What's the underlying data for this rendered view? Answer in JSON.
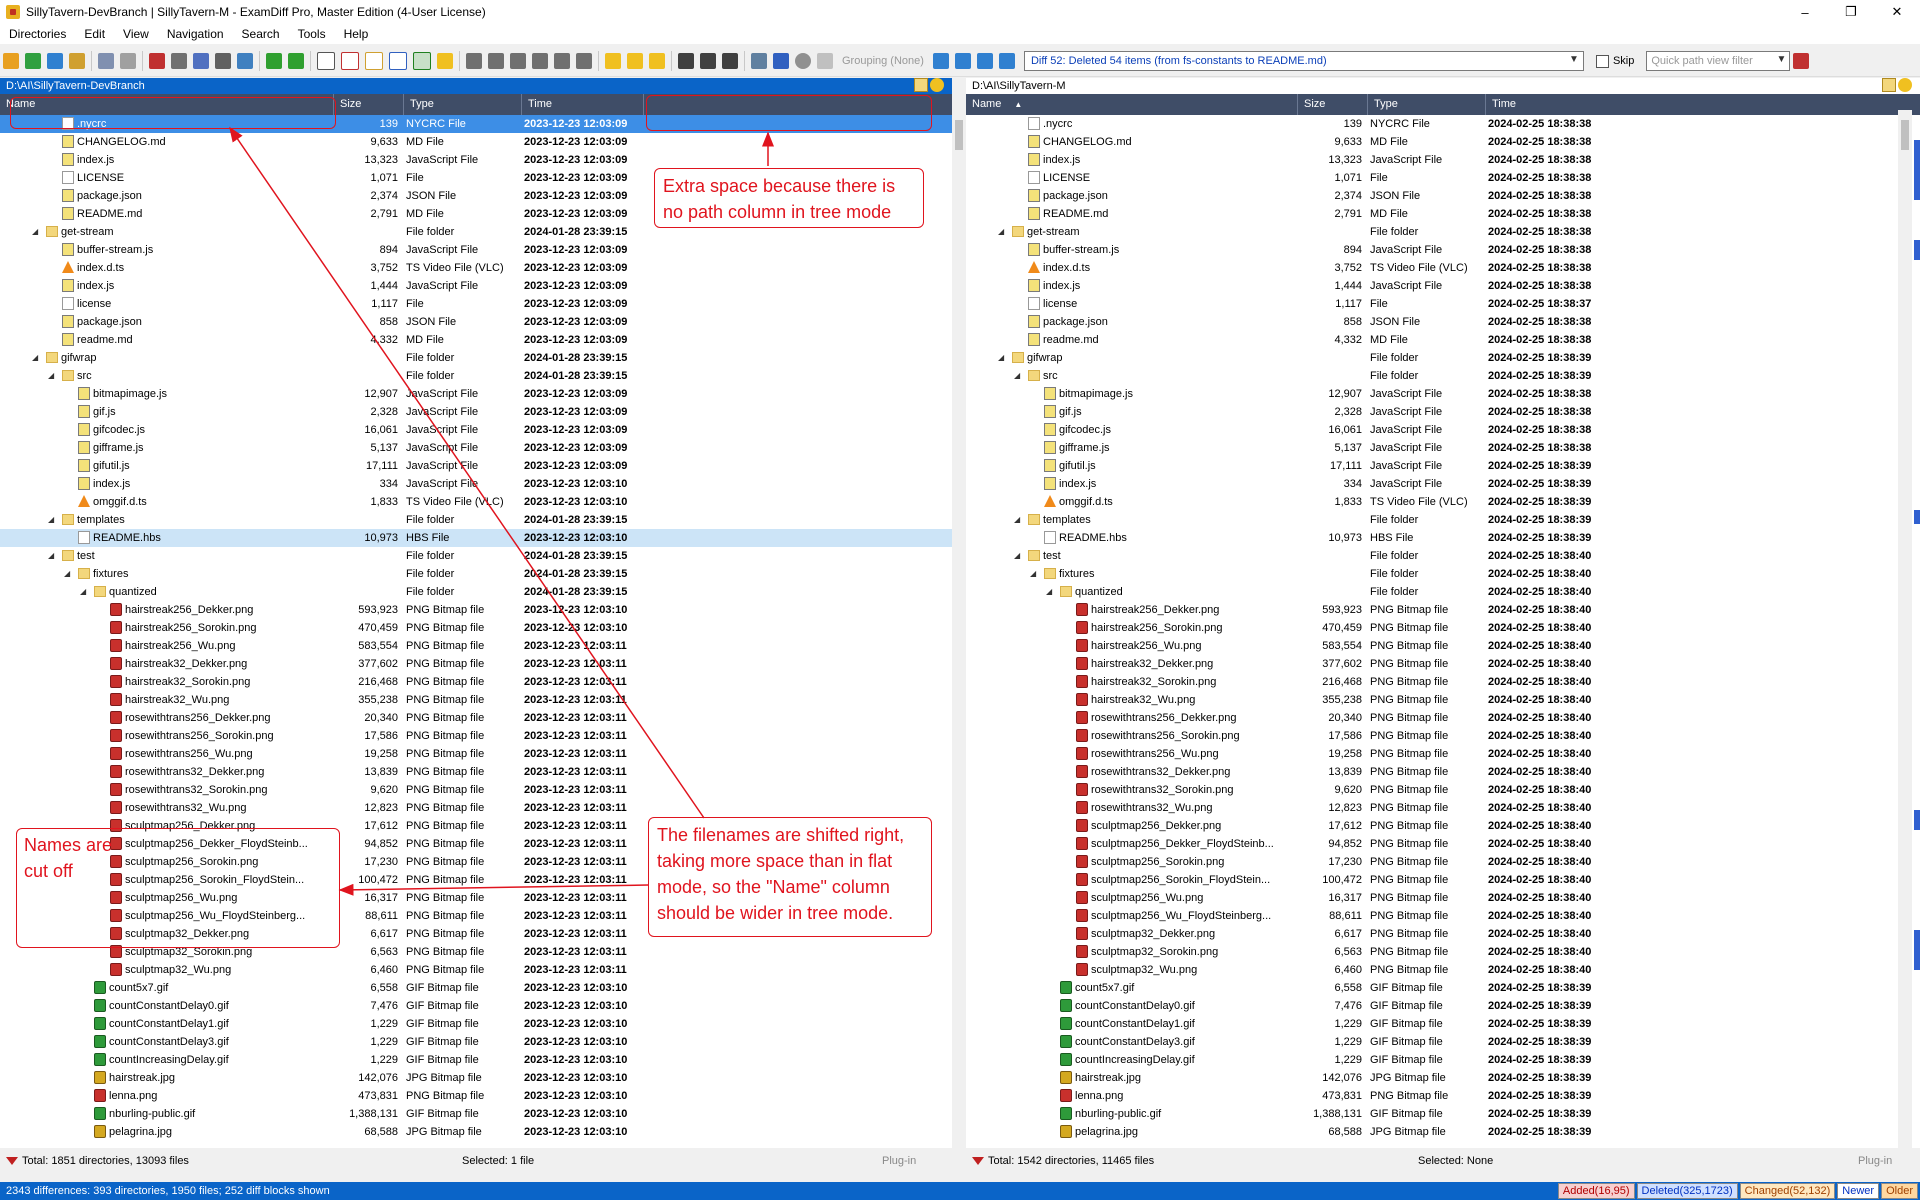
{
  "window": {
    "title": "SillyTavern-DevBranch  |  SillyTavern-M - ExamDiff Pro, Master Edition (4-User License)",
    "controls": [
      "–",
      "❐",
      "✕"
    ]
  },
  "menu": [
    "Directories",
    "Edit",
    "View",
    "Navigation",
    "Search",
    "Tools",
    "Help"
  ],
  "toolbar": {
    "grouping": "Grouping (None)",
    "diff_summary": "Diff 52: Deleted 54 items (from fs-constants to README.md)",
    "skip_label": "Skip",
    "quick_filter_placeholder": "Quick path view filter"
  },
  "left_pane": {
    "path": "D:\\AI\\SillyTavern-DevBranch",
    "columns": {
      "name": "Name",
      "size": "Size",
      "type": "Type",
      "time": "Time"
    },
    "status_total": "Total: 1851 directories, 13093 files",
    "status_selected": "Selected: 1 file",
    "status_plugin": "Plug-in"
  },
  "right_pane": {
    "path": "D:\\AI\\SillyTavern-M",
    "columns": {
      "name": "Name",
      "size": "Size",
      "type": "Type",
      "time": "Time"
    },
    "status_total": "Total: 1542 directories, 11465 files",
    "status_selected": "Selected: None",
    "status_plugin": "Plug-in"
  },
  "rows": [
    {
      "name": ".nycrc",
      "level": 3,
      "icon": "file",
      "size": "139",
      "type": "NYCRC File",
      "left_time": "2023-12-23 12:03:09",
      "right_time": "2024-02-25 18:38:38",
      "state": "sel"
    },
    {
      "name": "CHANGELOG.md",
      "level": 3,
      "icon": "js",
      "size": "9,633",
      "type": "MD File",
      "left_time": "2023-12-23 12:03:09",
      "right_time": "2024-02-25 18:38:38"
    },
    {
      "name": "index.js",
      "level": 3,
      "icon": "js",
      "size": "13,323",
      "type": "JavaScript File",
      "left_time": "2023-12-23 12:03:09",
      "right_time": "2024-02-25 18:38:38"
    },
    {
      "name": "LICENSE",
      "level": 3,
      "icon": "file",
      "size": "1,071",
      "type": "File",
      "left_time": "2023-12-23 12:03:09",
      "right_time": "2024-02-25 18:38:38"
    },
    {
      "name": "package.json",
      "level": 3,
      "icon": "js",
      "size": "2,374",
      "type": "JSON File",
      "left_time": "2023-12-23 12:03:09",
      "right_time": "2024-02-25 18:38:38"
    },
    {
      "name": "README.md",
      "level": 3,
      "icon": "js",
      "size": "2,791",
      "type": "MD File",
      "left_time": "2023-12-23 12:03:09",
      "right_time": "2024-02-25 18:38:38"
    },
    {
      "name": "get-stream",
      "level": 2,
      "icon": "folder",
      "tri": true,
      "size": "",
      "type": "File folder",
      "left_time": "2024-01-28 23:39:15",
      "right_time": "2024-02-25 18:38:38"
    },
    {
      "name": "buffer-stream.js",
      "level": 3,
      "icon": "js",
      "size": "894",
      "type": "JavaScript File",
      "left_time": "2023-12-23 12:03:09",
      "right_time": "2024-02-25 18:38:38"
    },
    {
      "name": "index.d.ts",
      "level": 3,
      "icon": "vlc",
      "size": "3,752",
      "type": "TS Video File (VLC)",
      "left_time": "2023-12-23 12:03:09",
      "right_time": "2024-02-25 18:38:38"
    },
    {
      "name": "index.js",
      "level": 3,
      "icon": "js",
      "size": "1,444",
      "type": "JavaScript File",
      "left_time": "2023-12-23 12:03:09",
      "right_time": "2024-02-25 18:38:38"
    },
    {
      "name": "license",
      "level": 3,
      "icon": "file",
      "size": "1,117",
      "type": "File",
      "left_time": "2023-12-23 12:03:09",
      "right_time": "2024-02-25 18:38:37"
    },
    {
      "name": "package.json",
      "level": 3,
      "icon": "js",
      "size": "858",
      "type": "JSON File",
      "left_time": "2023-12-23 12:03:09",
      "right_time": "2024-02-25 18:38:38"
    },
    {
      "name": "readme.md",
      "level": 3,
      "icon": "js",
      "size": "4,332",
      "type": "MD File",
      "left_time": "2023-12-23 12:03:09",
      "right_time": "2024-02-25 18:38:38"
    },
    {
      "name": "gifwrap",
      "level": 2,
      "icon": "folder",
      "tri": true,
      "size": "",
      "type": "File folder",
      "left_time": "2024-01-28 23:39:15",
      "right_time": "2024-02-25 18:38:39"
    },
    {
      "name": "src",
      "level": 3,
      "icon": "folder",
      "tri": true,
      "size": "",
      "type": "File folder",
      "left_time": "2024-01-28 23:39:15",
      "right_time": "2024-02-25 18:38:39"
    },
    {
      "name": "bitmapimage.js",
      "level": 4,
      "icon": "js",
      "size": "12,907",
      "type": "JavaScript File",
      "left_time": "2023-12-23 12:03:09",
      "right_time": "2024-02-25 18:38:38"
    },
    {
      "name": "gif.js",
      "level": 4,
      "icon": "js",
      "size": "2,328",
      "type": "JavaScript File",
      "left_time": "2023-12-23 12:03:09",
      "right_time": "2024-02-25 18:38:38"
    },
    {
      "name": "gifcodec.js",
      "level": 4,
      "icon": "js",
      "size": "16,061",
      "type": "JavaScript File",
      "left_time": "2023-12-23 12:03:09",
      "right_time": "2024-02-25 18:38:38"
    },
    {
      "name": "gifframe.js",
      "level": 4,
      "icon": "js",
      "size": "5,137",
      "type": "JavaScript File",
      "left_time": "2023-12-23 12:03:09",
      "right_time": "2024-02-25 18:38:38"
    },
    {
      "name": "gifutil.js",
      "level": 4,
      "icon": "js",
      "size": "17,111",
      "type": "JavaScript File",
      "left_time": "2023-12-23 12:03:09",
      "right_time": "2024-02-25 18:38:39"
    },
    {
      "name": "index.js",
      "level": 4,
      "icon": "js",
      "size": "334",
      "type": "JavaScript File",
      "left_time": "2023-12-23 12:03:10",
      "right_time": "2024-02-25 18:38:39"
    },
    {
      "name": "omggif.d.ts",
      "level": 4,
      "icon": "vlc",
      "size": "1,833",
      "type": "TS Video File (VLC)",
      "left_time": "2023-12-23 12:03:10",
      "right_time": "2024-02-25 18:38:39"
    },
    {
      "name": "templates",
      "level": 3,
      "icon": "folder",
      "tri": true,
      "size": "",
      "type": "File folder",
      "left_time": "2024-01-28 23:39:15",
      "right_time": "2024-02-25 18:38:39"
    },
    {
      "name": "README.hbs",
      "level": 4,
      "icon": "file",
      "size": "10,973",
      "type": "HBS File",
      "left_time": "2023-12-23 12:03:10",
      "right_time": "2024-02-25 18:38:39",
      "state": "hl"
    },
    {
      "name": "test",
      "level": 3,
      "icon": "folder",
      "tri": true,
      "size": "",
      "type": "File folder",
      "left_time": "2024-01-28 23:39:15",
      "right_time": "2024-02-25 18:38:40"
    },
    {
      "name": "fixtures",
      "level": 4,
      "icon": "folder",
      "tri": true,
      "size": "",
      "type": "File folder",
      "left_time": "2024-01-28 23:39:15",
      "right_time": "2024-02-25 18:38:40"
    },
    {
      "name": "quantized",
      "level": 5,
      "icon": "folder",
      "tri": true,
      "size": "",
      "type": "File folder",
      "left_time": "2024-01-28 23:39:15",
      "right_time": "2024-02-25 18:38:40"
    },
    {
      "name": "hairstreak256_Dekker.png",
      "level": 6,
      "icon": "img",
      "size": "593,923",
      "type": "PNG Bitmap file",
      "left_time": "2023-12-23 12:03:10",
      "right_time": "2024-02-25 18:38:40"
    },
    {
      "name": "hairstreak256_Sorokin.png",
      "level": 6,
      "icon": "img",
      "size": "470,459",
      "type": "PNG Bitmap file",
      "left_time": "2023-12-23 12:03:10",
      "right_time": "2024-02-25 18:38:40"
    },
    {
      "name": "hairstreak256_Wu.png",
      "level": 6,
      "icon": "img",
      "size": "583,554",
      "type": "PNG Bitmap file",
      "left_time": "2023-12-23 12:03:11",
      "right_time": "2024-02-25 18:38:40"
    },
    {
      "name": "hairstreak32_Dekker.png",
      "level": 6,
      "icon": "img",
      "size": "377,602",
      "type": "PNG Bitmap file",
      "left_time": "2023-12-23 12:03:11",
      "right_time": "2024-02-25 18:38:40"
    },
    {
      "name": "hairstreak32_Sorokin.png",
      "level": 6,
      "icon": "img",
      "size": "216,468",
      "type": "PNG Bitmap file",
      "left_time": "2023-12-23 12:03:11",
      "right_time": "2024-02-25 18:38:40"
    },
    {
      "name": "hairstreak32_Wu.png",
      "level": 6,
      "icon": "img",
      "size": "355,238",
      "type": "PNG Bitmap file",
      "left_time": "2023-12-23 12:03:11",
      "right_time": "2024-02-25 18:38:40"
    },
    {
      "name": "rosewithtrans256_Dekker.png",
      "level": 6,
      "icon": "img",
      "size": "20,340",
      "type": "PNG Bitmap file",
      "left_time": "2023-12-23 12:03:11",
      "right_time": "2024-02-25 18:38:40"
    },
    {
      "name": "rosewithtrans256_Sorokin.png",
      "level": 6,
      "icon": "img",
      "size": "17,586",
      "type": "PNG Bitmap file",
      "left_time": "2023-12-23 12:03:11",
      "right_time": "2024-02-25 18:38:40"
    },
    {
      "name": "rosewithtrans256_Wu.png",
      "level": 6,
      "icon": "img",
      "size": "19,258",
      "type": "PNG Bitmap file",
      "left_time": "2023-12-23 12:03:11",
      "right_time": "2024-02-25 18:38:40"
    },
    {
      "name": "rosewithtrans32_Dekker.png",
      "level": 6,
      "icon": "img",
      "size": "13,839",
      "type": "PNG Bitmap file",
      "left_time": "2023-12-23 12:03:11",
      "right_time": "2024-02-25 18:38:40"
    },
    {
      "name": "rosewithtrans32_Sorokin.png",
      "level": 6,
      "icon": "img",
      "size": "9,620",
      "type": "PNG Bitmap file",
      "left_time": "2023-12-23 12:03:11",
      "right_time": "2024-02-25 18:38:40"
    },
    {
      "name": "rosewithtrans32_Wu.png",
      "level": 6,
      "icon": "img",
      "size": "12,823",
      "type": "PNG Bitmap file",
      "left_time": "2023-12-23 12:03:11",
      "right_time": "2024-02-25 18:38:40"
    },
    {
      "name": "sculptmap256_Dekker.png",
      "level": 6,
      "icon": "img",
      "size": "17,612",
      "type": "PNG Bitmap file",
      "left_time": "2023-12-23 12:03:11",
      "right_time": "2024-02-25 18:38:40"
    },
    {
      "name": "sculptmap256_Dekker_FloydSteinb...",
      "level": 6,
      "icon": "img",
      "size": "94,852",
      "type": "PNG Bitmap file",
      "left_time": "2023-12-23 12:03:11",
      "right_time": "2024-02-25 18:38:40"
    },
    {
      "name": "sculptmap256_Sorokin.png",
      "level": 6,
      "icon": "img",
      "size": "17,230",
      "type": "PNG Bitmap file",
      "left_time": "2023-12-23 12:03:11",
      "right_time": "2024-02-25 18:38:40"
    },
    {
      "name": "sculptmap256_Sorokin_FloydStein...",
      "level": 6,
      "icon": "img",
      "size": "100,472",
      "type": "PNG Bitmap file",
      "left_time": "2023-12-23 12:03:11",
      "right_time": "2024-02-25 18:38:40"
    },
    {
      "name": "sculptmap256_Wu.png",
      "level": 6,
      "icon": "img",
      "size": "16,317",
      "type": "PNG Bitmap file",
      "left_time": "2023-12-23 12:03:11",
      "right_time": "2024-02-25 18:38:40"
    },
    {
      "name": "sculptmap256_Wu_FloydSteinberg...",
      "level": 6,
      "icon": "img",
      "size": "88,611",
      "type": "PNG Bitmap file",
      "left_time": "2023-12-23 12:03:11",
      "right_time": "2024-02-25 18:38:40"
    },
    {
      "name": "sculptmap32_Dekker.png",
      "level": 6,
      "icon": "img",
      "size": "6,617",
      "type": "PNG Bitmap file",
      "left_time": "2023-12-23 12:03:11",
      "right_time": "2024-02-25 18:38:40"
    },
    {
      "name": "sculptmap32_Sorokin.png",
      "level": 6,
      "icon": "img",
      "size": "6,563",
      "type": "PNG Bitmap file",
      "left_time": "2023-12-23 12:03:11",
      "right_time": "2024-02-25 18:38:40"
    },
    {
      "name": "sculptmap32_Wu.png",
      "level": 6,
      "icon": "img",
      "size": "6,460",
      "type": "PNG Bitmap file",
      "left_time": "2023-12-23 12:03:11",
      "right_time": "2024-02-25 18:38:40"
    },
    {
      "name": "count5x7.gif",
      "level": 5,
      "icon": "gif",
      "size": "6,558",
      "type": "GIF Bitmap file",
      "left_time": "2023-12-23 12:03:10",
      "right_time": "2024-02-25 18:38:39"
    },
    {
      "name": "countConstantDelay0.gif",
      "level": 5,
      "icon": "gif",
      "size": "7,476",
      "type": "GIF Bitmap file",
      "left_time": "2023-12-23 12:03:10",
      "right_time": "2024-02-25 18:38:39"
    },
    {
      "name": "countConstantDelay1.gif",
      "level": 5,
      "icon": "gif",
      "size": "1,229",
      "type": "GIF Bitmap file",
      "left_time": "2023-12-23 12:03:10",
      "right_time": "2024-02-25 18:38:39"
    },
    {
      "name": "countConstantDelay3.gif",
      "level": 5,
      "icon": "gif",
      "size": "1,229",
      "type": "GIF Bitmap file",
      "left_time": "2023-12-23 12:03:10",
      "right_time": "2024-02-25 18:38:39"
    },
    {
      "name": "countIncreasingDelay.gif",
      "level": 5,
      "icon": "gif",
      "size": "1,229",
      "type": "GIF Bitmap file",
      "left_time": "2023-12-23 12:03:10",
      "right_time": "2024-02-25 18:38:39"
    },
    {
      "name": "hairstreak.jpg",
      "level": 5,
      "icon": "jpg",
      "size": "142,076",
      "type": "JPG Bitmap file",
      "left_time": "2023-12-23 12:03:10",
      "right_time": "2024-02-25 18:38:39"
    },
    {
      "name": "lenna.png",
      "level": 5,
      "icon": "img",
      "size": "473,831",
      "type": "PNG Bitmap file",
      "left_time": "2023-12-23 12:03:10",
      "right_time": "2024-02-25 18:38:39"
    },
    {
      "name": "nburling-public.gif",
      "level": 5,
      "icon": "gif",
      "size": "1,388,131",
      "type": "GIF Bitmap file",
      "left_time": "2023-12-23 12:03:10",
      "right_time": "2024-02-25 18:38:39"
    },
    {
      "name": "pelagrina.jpg",
      "level": 5,
      "icon": "jpg",
      "size": "68,588",
      "type": "JPG Bitmap file",
      "left_time": "2023-12-23 12:03:10",
      "right_time": "2024-02-25 18:38:39"
    }
  ],
  "statusbar": {
    "summary": "2343 differences: 393 directories, 1950 files; 252 diff blocks shown",
    "added": "Added(16,95)",
    "deleted": "Deleted(325,1723)",
    "changed": "Changed(52,132)",
    "newer": "Newer",
    "older": "Older"
  },
  "annotations": {
    "extra_space": "Extra space because there is no path column in tree mode",
    "shifted": "The filenames are shifted right, taking more space than in flat mode, so the \"Name\" column should be wider in tree mode.",
    "cut_off": "Names are cut off"
  },
  "colors": {
    "accent": "#0a64c8",
    "header": "#3f4d67",
    "selection": "#3d8ee6",
    "annotation": "#e0141e"
  }
}
